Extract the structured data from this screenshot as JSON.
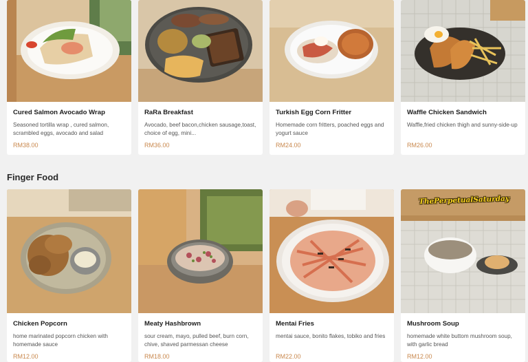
{
  "top_items": [
    {
      "name": "Cured Salmon Avocado Wrap",
      "description": "Seasoned tortilla wrap , cured salmon, scrambled eggs, avocado and salad",
      "price": "RM38.00",
      "image_icon": "salmon-wrap-photo"
    },
    {
      "name": "RaRa Breakfast",
      "description": "Avocado, beef bacon,chicken sausage,toast, choice of egg, mini...",
      "price": "RM36.00",
      "image_icon": "breakfast-photo"
    },
    {
      "name": "Turkish Egg Corn Fritter",
      "description": "Homemade corn fritters, poached eggs and yogurt sauce",
      "price": "RM24.00",
      "image_icon": "corn-fritter-photo"
    },
    {
      "name": "Waffle Chicken Sandwich",
      "description": "Waffle,fried chicken thigh and sunny-side-up",
      "price": "RM26.00",
      "image_icon": "waffle-photo"
    }
  ],
  "finger_food": {
    "title": "Finger Food",
    "items": [
      {
        "name": "Chicken Popcorn",
        "description": "home marinated popcorn chicken with homemade sauce",
        "price": "RM12.00",
        "image_icon": "popcorn-chicken-photo"
      },
      {
        "name": "Meaty Hashbrown",
        "description": "sour cream, mayo, pulled beef, burn corn, chive, shaved parmessan cheese",
        "price": "RM18.00",
        "image_icon": "hashbrown-photo"
      },
      {
        "name": "Mentai Fries",
        "description": "mentai sauce, bonito flakes, tobiko and fries",
        "price": "RM22.00",
        "image_icon": "mentai-fries-photo"
      },
      {
        "name": "Mushroom Soup",
        "description": "homemade white buttom mushroom soup, with garlic bread",
        "price": "RM12.00",
        "image_icon": "mushroom-soup-photo"
      }
    ]
  },
  "watermark": "ThePerpetualSaturday",
  "colors": {
    "background": "#f1f1f1",
    "card": "#ffffff",
    "price": "#c8874c",
    "title": "#1d1d1d",
    "description": "#555555"
  }
}
